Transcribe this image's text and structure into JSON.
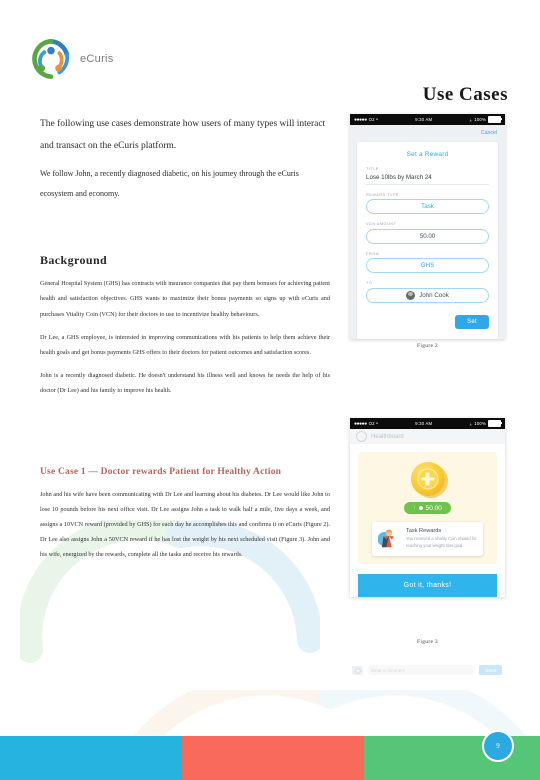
{
  "brand": {
    "logo_icon": "ecuris-swirl-logo",
    "name": "eCuris"
  },
  "header": {
    "title": "Use Cases"
  },
  "intro": {
    "paragraph_1": "The following use cases demonstrate how users of many types will interact and transact on the eCuris platform.",
    "paragraph_2": "We follow John, a recently diagnosed diabetic, on his journey through the eCuris ecosystem and economy."
  },
  "background": {
    "heading": "Background",
    "paragraph_1": "General Hospital System (GHS) has contracts with insurance companies that pay them bonuses for achieving patient health and satisfaction objectives. GHS wants to maximize their bonus payments so signs up with eCuris and purchases Vitality Coin (VCN) for their doctors to use to incentivize healthy behaviours.",
    "paragraph_2": "Dr Lee, a GHS employee, is interested in improving communications with his patients to help them achieve their health goals and get bonus payments GHS offers to their doctors for patient outcomes and satisfaction scores.",
    "paragraph_3": "John is a recently diagnosed diabetic. He doesn't understand his illness well and knows he needs the help of his doctor (Dr Lee) and his family to improve his health."
  },
  "use_case_1": {
    "heading": "Use Case 1 — Doctor rewards Patient for Healthy Action",
    "paragraph": "John and his wife have been communicating with Dr Lee and learning about his diabetes. Dr Lee would like John to lose 10 pounds before his next office visit. Dr Lee assigns John a task to walk half a mile, five days a week, and assigns a 10VCN reward (provided by GHS) for each day he accomplishes this and confirms it on eCuris (Figure 2). Dr Lee also assigns John a 50VCN reward if he has lost the weight by his next scheduled visit (Figure 3). John and his wife, energized by the rewards, complete all the tasks and receive his rewards."
  },
  "figure_2": {
    "caption": "Figure 2",
    "status_bar": {
      "signal": "●●●●●",
      "carrier": "O2 ᵜ",
      "time": "9:30 AM",
      "bluetooth": "ᛦ",
      "battery_pct": "100%"
    },
    "nav": {
      "cancel_label": "Cancel"
    },
    "form": {
      "title": "Set a Reward",
      "title_label": "TITLE",
      "title_value": "Lose 10lbs by March 24",
      "reward_type_label": "REWARD TYPE",
      "reward_type_value": "Task",
      "vcn_amount_label": "VCN AMOUNT",
      "vcn_amount_value": "50.00",
      "from_label": "FROM",
      "from_value": "GHS",
      "to_label": "TO",
      "to_value": "John Cook",
      "to_avatar_icon": "user-avatar-icon",
      "submit_label": "Set"
    }
  },
  "figure_3": {
    "caption": "Figure 3",
    "status_bar": {
      "signal": "●●●●●",
      "carrier": "O2 ᵜ",
      "time": "9:30 AM",
      "bluetooth": "ᛦ",
      "battery_pct": "100%"
    },
    "header_title": "Healthboard",
    "header_logo_icon": "ecuris-circle-icon",
    "reward": {
      "coin_icon": "vitality-coin-icon",
      "amount_arrow": "↑",
      "amount_value": "50.00"
    },
    "notification": {
      "illustration_icon": "doctor-patient-illustration",
      "title": "Task Rewards",
      "body": "You received a Vitality Coin reward for reaching your weight loss goal."
    },
    "confirm_label": "Got it, thanks!",
    "comment_bar": {
      "camera_icon": "camera-icon",
      "placeholder": "Write a comment",
      "send_label": "Send"
    }
  },
  "footer": {
    "page_number": "9",
    "bar_colors": [
      "#26b3e0",
      "#f96a5a",
      "#55c578"
    ]
  },
  "colors": {
    "accent_blue": "#2fa8e8",
    "accent_green": "#6cc24a",
    "accent_gold": "#fbc82e",
    "usecase_heading": "#b5655c"
  }
}
